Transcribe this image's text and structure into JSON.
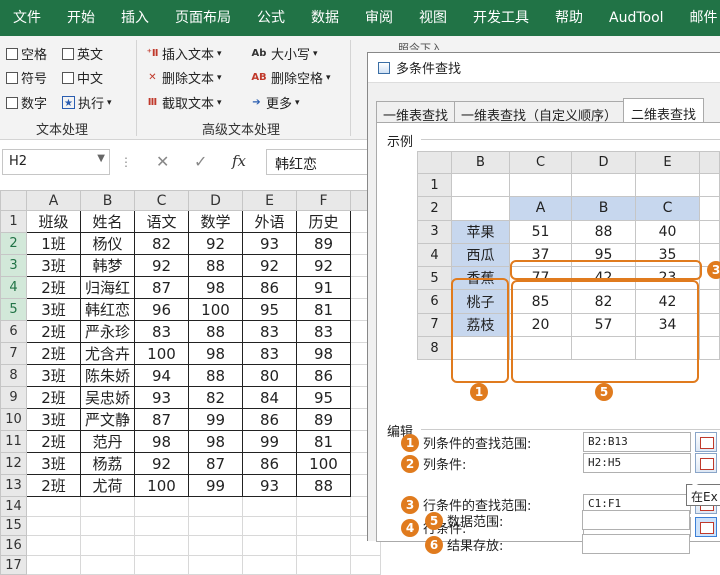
{
  "menu": [
    "文件",
    "开始",
    "插入",
    "页面布局",
    "公式",
    "数据",
    "审阅",
    "视图",
    "开发工具",
    "帮助",
    "AudTool",
    "邮件"
  ],
  "ribbon": {
    "group1": {
      "items": [
        "空格",
        "英文",
        "符号",
        "中文",
        "数字",
        "执行"
      ],
      "label": "文本处理"
    },
    "group2": {
      "items": [
        "插入文本",
        "删除文本",
        "截取文本",
        "大小写",
        "删除空格",
        "更多"
      ],
      "label": "高级文本处理"
    },
    "partial_label": "照今下入"
  },
  "formula_bar": {
    "namebox": "H2",
    "formula": "韩红恋",
    "fx": "fx"
  },
  "sheet": {
    "columns": [
      "A",
      "B",
      "C",
      "D",
      "E",
      "F"
    ],
    "rows": [
      {
        "n": "1",
        "cells": [
          "班级",
          "姓名",
          "语文",
          "数学",
          "外语",
          "历史"
        ]
      },
      {
        "n": "2",
        "cells": [
          "1班",
          "杨仪",
          "82",
          "92",
          "93",
          "89"
        ]
      },
      {
        "n": "3",
        "cells": [
          "3班",
          "韩梦",
          "92",
          "88",
          "92",
          "92"
        ]
      },
      {
        "n": "4",
        "cells": [
          "2班",
          "归海红",
          "87",
          "98",
          "86",
          "91"
        ]
      },
      {
        "n": "5",
        "cells": [
          "3班",
          "韩红恋",
          "96",
          "100",
          "95",
          "81"
        ]
      },
      {
        "n": "6",
        "cells": [
          "2班",
          "严永珍",
          "83",
          "88",
          "83",
          "83"
        ]
      },
      {
        "n": "7",
        "cells": [
          "2班",
          "尤含卉",
          "100",
          "98",
          "83",
          "98"
        ]
      },
      {
        "n": "8",
        "cells": [
          "3班",
          "陈朱娇",
          "94",
          "88",
          "80",
          "86"
        ]
      },
      {
        "n": "9",
        "cells": [
          "2班",
          "吴忠娇",
          "93",
          "82",
          "84",
          "95"
        ]
      },
      {
        "n": "10",
        "cells": [
          "3班",
          "严文静",
          "87",
          "99",
          "86",
          "89"
        ]
      },
      {
        "n": "11",
        "cells": [
          "2班",
          "范丹",
          "98",
          "98",
          "99",
          "81"
        ]
      },
      {
        "n": "12",
        "cells": [
          "3班",
          "杨荔",
          "92",
          "87",
          "86",
          "100"
        ]
      },
      {
        "n": "13",
        "cells": [
          "2班",
          "尤荷",
          "100",
          "99",
          "93",
          "88"
        ]
      },
      {
        "n": "14",
        "cells": [
          "",
          "",
          "",
          "",
          "",
          ""
        ]
      },
      {
        "n": "15",
        "cells": [
          "",
          "",
          "",
          "",
          "",
          ""
        ]
      },
      {
        "n": "16",
        "cells": [
          "",
          "",
          "",
          "",
          "",
          ""
        ]
      },
      {
        "n": "17",
        "cells": [
          "",
          "",
          "",
          "",
          "",
          ""
        ]
      }
    ]
  },
  "dialog": {
    "title": "多条件查找",
    "tabs": [
      "一维表查找",
      "一维表查找（自定义顺序）",
      "二维表查找"
    ],
    "example_label": "示例",
    "example": {
      "columns": [
        "B",
        "C",
        "D",
        "E"
      ],
      "rows": [
        {
          "n": "1",
          "cells": [
            "",
            "",
            "",
            ""
          ]
        },
        {
          "n": "2",
          "cells": [
            "",
            "A",
            "B",
            "C"
          ]
        },
        {
          "n": "3",
          "cells": [
            "苹果",
            "51",
            "88",
            "40"
          ]
        },
        {
          "n": "4",
          "cells": [
            "西瓜",
            "37",
            "95",
            "35"
          ]
        },
        {
          "n": "5",
          "cells": [
            "香蕉",
            "77",
            "42",
            "23"
          ]
        },
        {
          "n": "6",
          "cells": [
            "桃子",
            "85",
            "82",
            "42"
          ]
        },
        {
          "n": "7",
          "cells": [
            "荔枝",
            "20",
            "57",
            "34"
          ]
        },
        {
          "n": "8",
          "cells": [
            "",
            "",
            "",
            ""
          ]
        }
      ],
      "badges": [
        "1",
        "3",
        "5"
      ]
    },
    "edit_label": "编辑",
    "fields": [
      {
        "num": "1",
        "label": "列条件的查找范围:",
        "value": "B2:B13"
      },
      {
        "num": "2",
        "label": "列条件:",
        "value": "H2:H5"
      },
      {
        "num": "3",
        "label": "行条件的查找范围:",
        "value": "C1:F1"
      },
      {
        "num": "4",
        "label": "行条件:",
        "value": ""
      },
      {
        "num": "5",
        "label": "数据范围:",
        "value": ""
      },
      {
        "num": "6",
        "label": "结果存放:",
        "value": ""
      }
    ],
    "tooltip": "在Ex"
  }
}
